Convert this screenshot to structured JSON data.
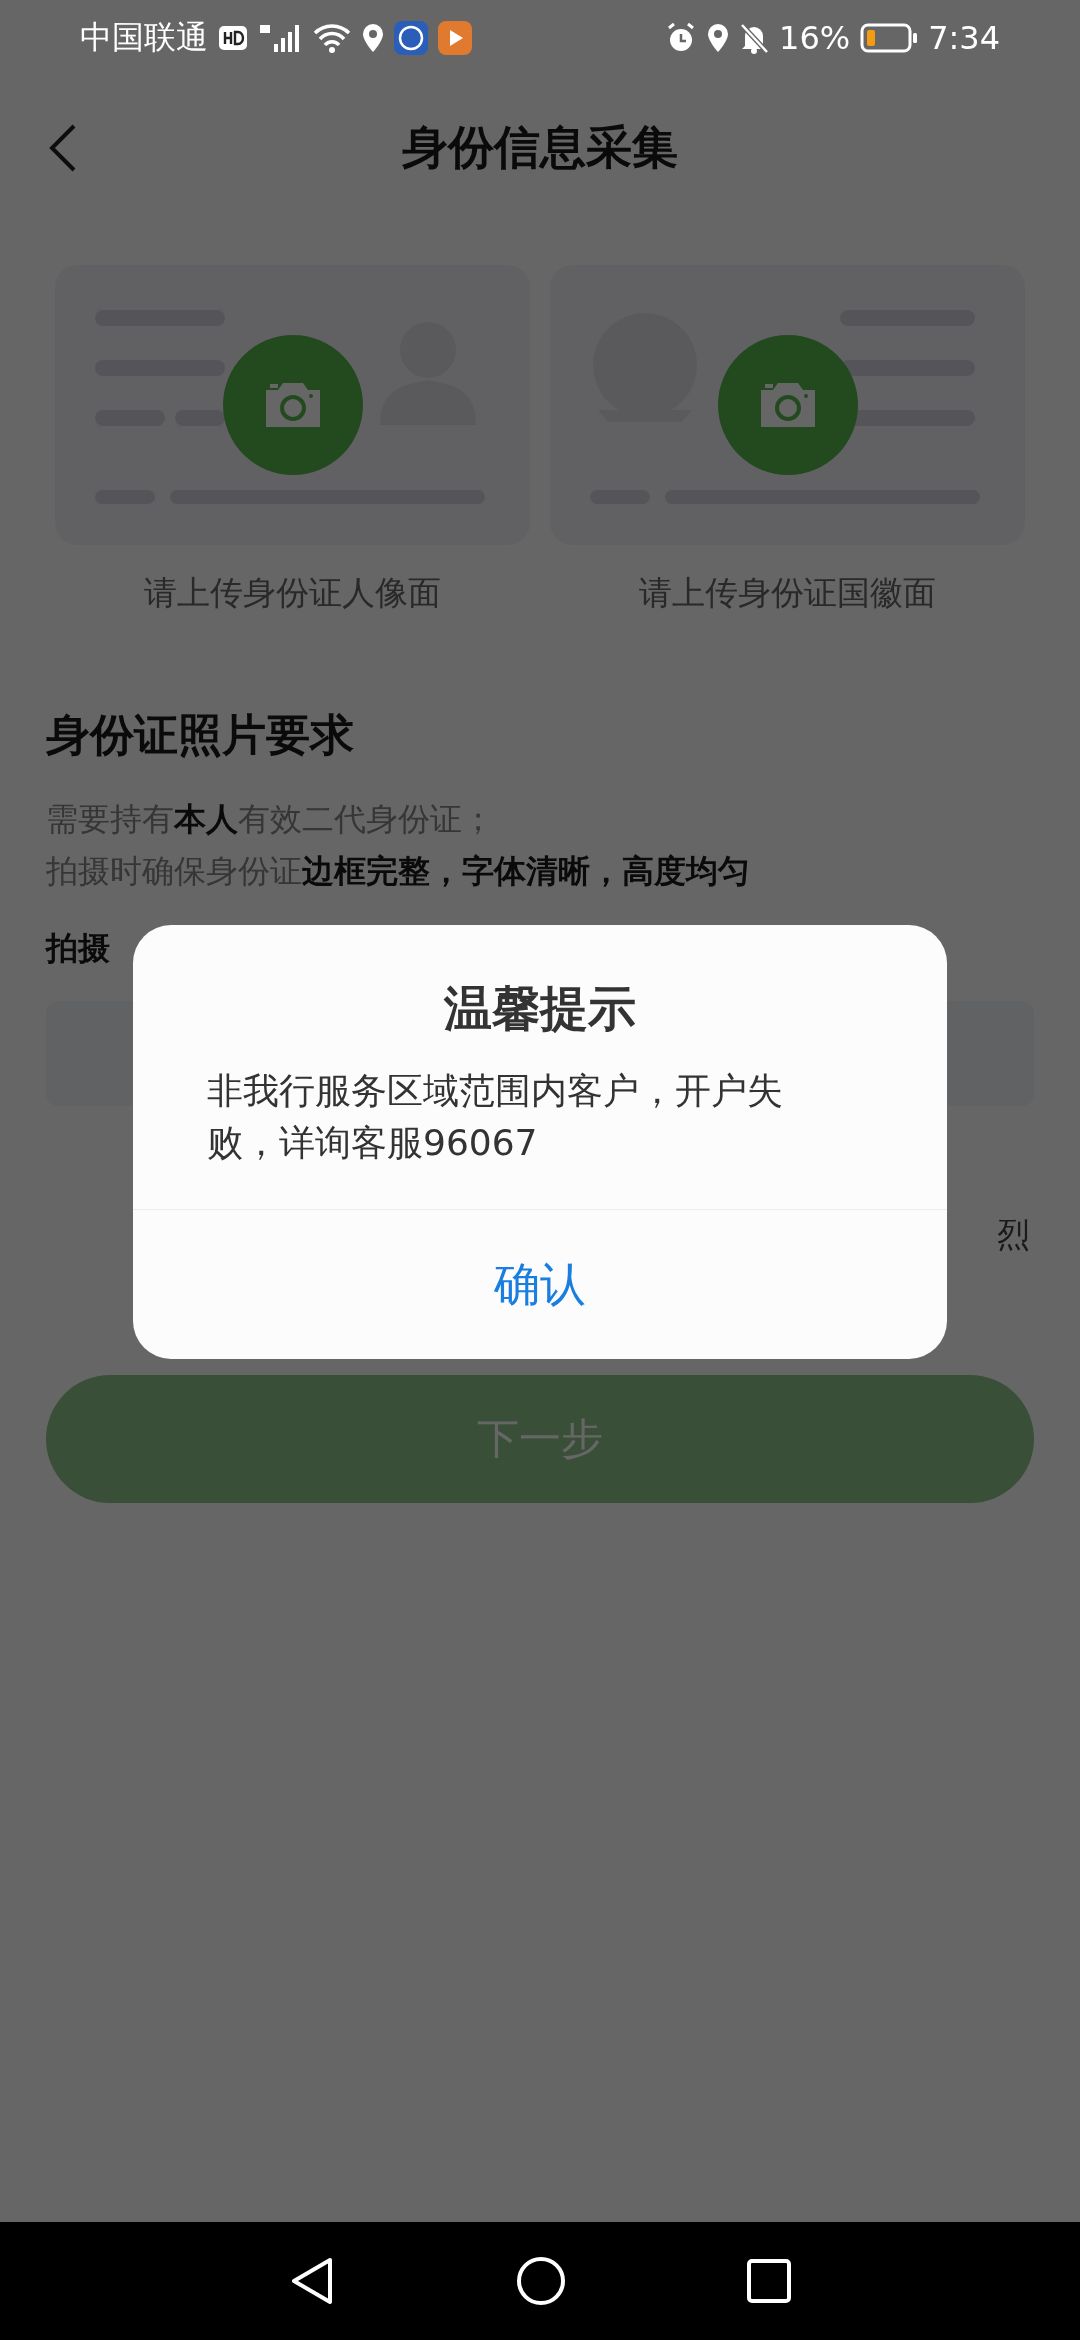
{
  "status_bar": {
    "carrier": "中国联通",
    "battery": "16%",
    "time": "7:34"
  },
  "header": {
    "title": "身份信息采集"
  },
  "upload_cards": [
    {
      "kind": "portrait",
      "caption": "请上传身份证人像面"
    },
    {
      "kind": "emblem",
      "caption": "请上传身份证国徽面"
    }
  ],
  "requirements": {
    "title": "身份证照片要求",
    "lines": [
      "需要持有**本人**有效二代身份证；",
      "拍摄时确保身份证**边框完整，字体清晰，高度均匀**"
    ]
  },
  "shooting_tips": {
    "title": "拍摄",
    "right_label": "烈"
  },
  "next_button": {
    "label": "下一步",
    "disabled": true
  },
  "dialog": {
    "title": "温馨提示",
    "message": "非我行服务区域范围内客户，开户失败，详询客服96067",
    "confirm": "确认"
  }
}
